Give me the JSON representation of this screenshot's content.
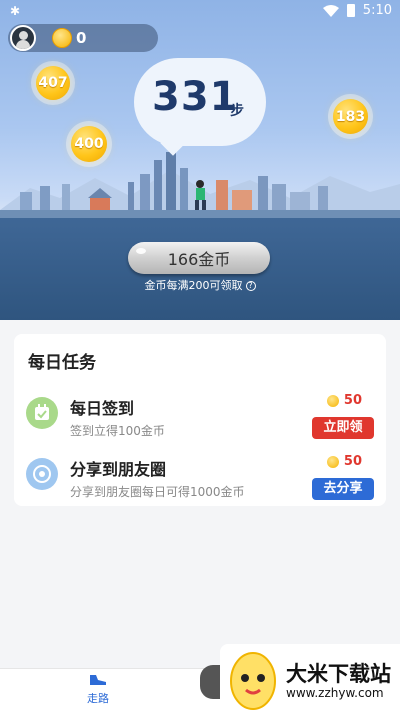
{
  "status_bar": {
    "time": "5:10"
  },
  "user": {
    "coins": "0"
  },
  "bubbles": [
    "407",
    "400",
    "183"
  ],
  "steps": {
    "value": "331",
    "unit": "步"
  },
  "collect": {
    "button_label": "166金币",
    "hint": "金币每满200可领取"
  },
  "tasks": {
    "title": "每日任务",
    "items": [
      {
        "name": "每日签到",
        "desc": "签到立得100金币",
        "reward": "50",
        "button": "立即领"
      },
      {
        "name": "分享到朋友圈",
        "desc": "分享到朋友圈每日可得1000金币",
        "reward": "50",
        "button": "去分享"
      }
    ]
  },
  "nav": {
    "walk_label": "走路"
  },
  "watermark": {
    "title": "大米下载站",
    "url": "www.zzhyw.com"
  },
  "colors": {
    "accent_blue": "#2d6bd6",
    "accent_red": "#e0372e",
    "coin_gold": "#f5b300"
  }
}
